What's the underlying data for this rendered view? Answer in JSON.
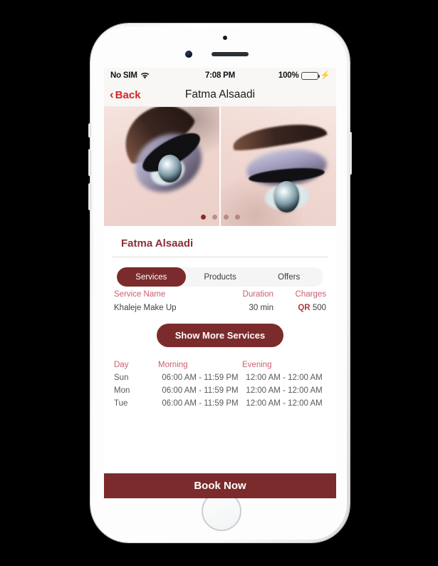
{
  "status_bar": {
    "carrier": "No SIM",
    "wifi_icon": "wifi-icon",
    "time": "7:08 PM",
    "battery_percent": "100%",
    "battery_icon": "battery-full-icon",
    "charging_icon": "lightning-bolt-icon"
  },
  "nav": {
    "back_label": "Back",
    "back_icon": "chevron-left-icon",
    "title": "Fatma Alsaadi"
  },
  "carousel": {
    "slides": [
      {
        "alt": "eye-makeup-photo-1"
      },
      {
        "alt": "eye-makeup-photo-2"
      }
    ],
    "dots": 4,
    "active_dot": 0
  },
  "profile": {
    "name": "Fatma Alsaadi"
  },
  "tabs": [
    {
      "label": "Services",
      "active": true
    },
    {
      "label": "Products",
      "active": false
    },
    {
      "label": "Offers",
      "active": false
    }
  ],
  "services_table": {
    "headers": {
      "name": "Service Name",
      "duration": "Duration",
      "charges": "Charges"
    },
    "rows": [
      {
        "name": "Khaleje Make Up",
        "duration": "30 min",
        "currency": "QR",
        "amount": "500"
      }
    ]
  },
  "show_more_button": {
    "label": "Show More Services"
  },
  "schedule": {
    "headers": {
      "day": "Day",
      "morning": "Morning",
      "evening": "Evening"
    },
    "rows": [
      {
        "day": "Sun",
        "morning": "06:00 AM - 11:59 PM",
        "evening": "12:00 AM - 12:00 AM"
      },
      {
        "day": "Mon",
        "morning": "06:00 AM - 11:59 PM",
        "evening": "12:00 AM - 12:00 AM"
      },
      {
        "day": "Tue",
        "morning": "06:00 AM - 11:59 PM",
        "evening": "12:00 AM - 12:00 AM"
      }
    ]
  },
  "book_now": {
    "label": "Book Now"
  },
  "colors": {
    "maroon": "#7b2b2b",
    "title_maroon": "#8b3038",
    "rose": "#c9606f",
    "back_red": "#d42626",
    "battery_green": "#3ddc55"
  }
}
